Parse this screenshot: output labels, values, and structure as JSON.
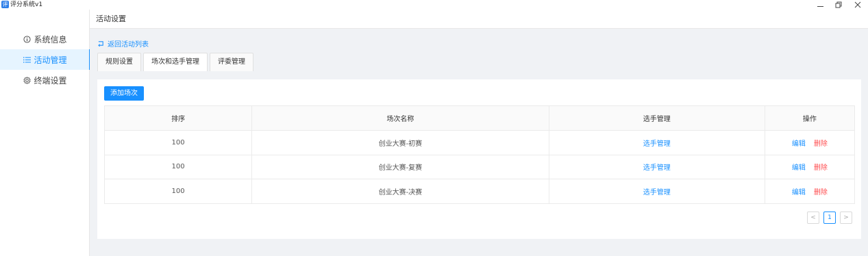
{
  "window": {
    "app_icon_glyph": "评",
    "title": "评分系统v1",
    "minimize_icon": "minimize-icon",
    "restore_icon": "restore-icon",
    "close_icon": "close-icon"
  },
  "sidebar": {
    "items": [
      {
        "label": "系统信息",
        "icon": "info-circle-icon",
        "active": false
      },
      {
        "label": "活动管理",
        "icon": "list-icon",
        "active": true
      },
      {
        "label": "终端设置",
        "icon": "gear-icon",
        "active": false
      }
    ]
  },
  "header": {
    "title": "活动设置"
  },
  "main": {
    "back_link": "返回活动列表",
    "tabs": [
      {
        "label": "规则设置",
        "active": false
      },
      {
        "label": "场次和选手管理",
        "active": true
      },
      {
        "label": "评委管理",
        "active": false
      }
    ],
    "add_button": "添加场次",
    "table": {
      "headers": [
        "排序",
        "场次名称",
        "选手管理",
        "操作"
      ],
      "rows": [
        {
          "order": "100",
          "name": "创业大赛-初赛",
          "manage": "选手管理",
          "edit": "编辑",
          "delete": "删除"
        },
        {
          "order": "100",
          "name": "创业大赛-复赛",
          "manage": "选手管理",
          "edit": "编辑",
          "delete": "删除"
        },
        {
          "order": "100",
          "name": "创业大赛-决赛",
          "manage": "选手管理",
          "edit": "编辑",
          "delete": "删除"
        }
      ]
    },
    "pagination": {
      "prev": "<",
      "current": "1",
      "next": ">"
    }
  },
  "colors": {
    "accent": "#1890ff",
    "danger": "#ff4d4f",
    "background": "#f0f2f5"
  }
}
